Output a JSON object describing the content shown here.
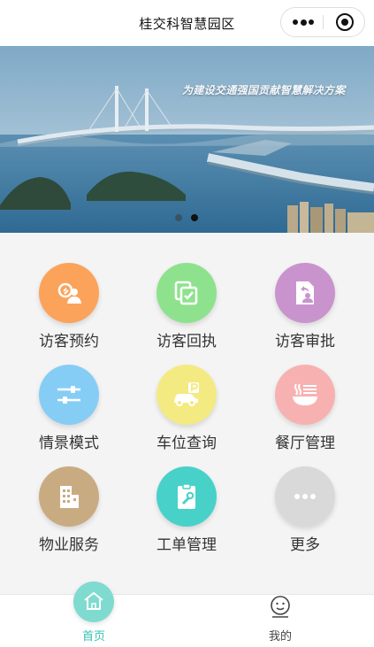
{
  "nav": {
    "title": "桂交科智慧园区"
  },
  "banner": {
    "caption": "为建设交通强国贡献智慧解决方案",
    "active_slide": 2,
    "slide_count": 2
  },
  "grid": {
    "items": [
      {
        "label": "访客预约",
        "icon": "visitor-booking-icon",
        "color": "#fba35a"
      },
      {
        "label": "访客回执",
        "icon": "visitor-receipt-icon",
        "color": "#8fe28d"
      },
      {
        "label": "访客审批",
        "icon": "visitor-approval-icon",
        "color": "#c994cd"
      },
      {
        "label": "情景模式",
        "icon": "scene-mode-icon",
        "color": "#86cdf6"
      },
      {
        "label": "车位查询",
        "icon": "parking-query-icon",
        "color": "#f4ea82"
      },
      {
        "label": "餐厅管理",
        "icon": "restaurant-icon",
        "color": "#f8b1b1"
      },
      {
        "label": "物业服务",
        "icon": "property-service-icon",
        "color": "#c9ab82"
      },
      {
        "label": "工单管理",
        "icon": "work-order-icon",
        "color": "#47d1c9"
      },
      {
        "label": "更多",
        "icon": "more-icon",
        "color": "#d9d9d9"
      }
    ]
  },
  "tabbar": {
    "home_label": "首页",
    "mine_label": "我的",
    "active_tab": "首页",
    "active_color": "#35c1b2"
  }
}
